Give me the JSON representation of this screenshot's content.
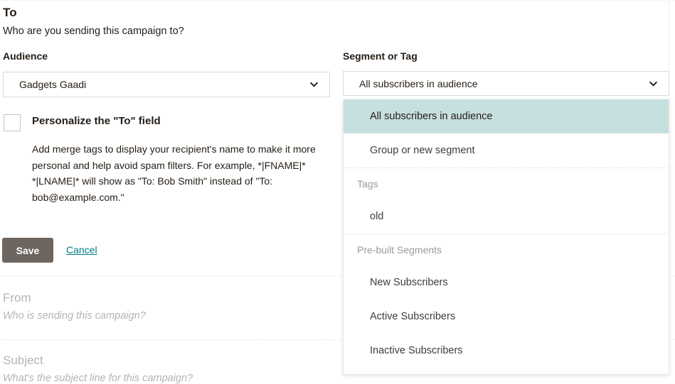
{
  "section": {
    "title": "To",
    "subtitle": "Who are you sending this campaign to?"
  },
  "audience": {
    "label": "Audience",
    "selected": "Gadgets Gaadi",
    "chevron_icon": "chevron-down-icon"
  },
  "personalize": {
    "checkbox_label": "Personalize the \"To\" field",
    "checked": false,
    "help_text": "Add merge tags to display your recipient's name to make it more personal and help avoid spam filters. For example, *|FNAME|* *|LNAME|* will show as \"To: Bob Smith\" instead of \"To: bob@example.com.\""
  },
  "actions": {
    "save_label": "Save",
    "cancel_label": "Cancel",
    "save_color": "#6c6560",
    "cancel_color": "#007c89"
  },
  "segment": {
    "label": "Segment or Tag",
    "selected": "All subscribers in audience",
    "chevron_icon": "chevron-down-icon",
    "dropdown": {
      "open": true,
      "highlight_color": "#c6e0df",
      "items": [
        {
          "label": "All subscribers in audience",
          "selected": true
        },
        {
          "label": "Group or new segment",
          "selected": false
        }
      ],
      "groups": [
        {
          "title": "Tags",
          "items": [
            {
              "label": "old",
              "selected": false
            }
          ]
        },
        {
          "title": "Pre-built Segments",
          "items": [
            {
              "label": "New Subscribers",
              "selected": false
            },
            {
              "label": "Active Subscribers",
              "selected": false
            },
            {
              "label": "Inactive Subscribers",
              "selected": false
            }
          ]
        }
      ]
    }
  },
  "from_section": {
    "title": "From",
    "subtitle": "Who is sending this campaign?"
  },
  "subject_section": {
    "title": "Subject",
    "subtitle": "What's the subject line for this campaign?"
  }
}
